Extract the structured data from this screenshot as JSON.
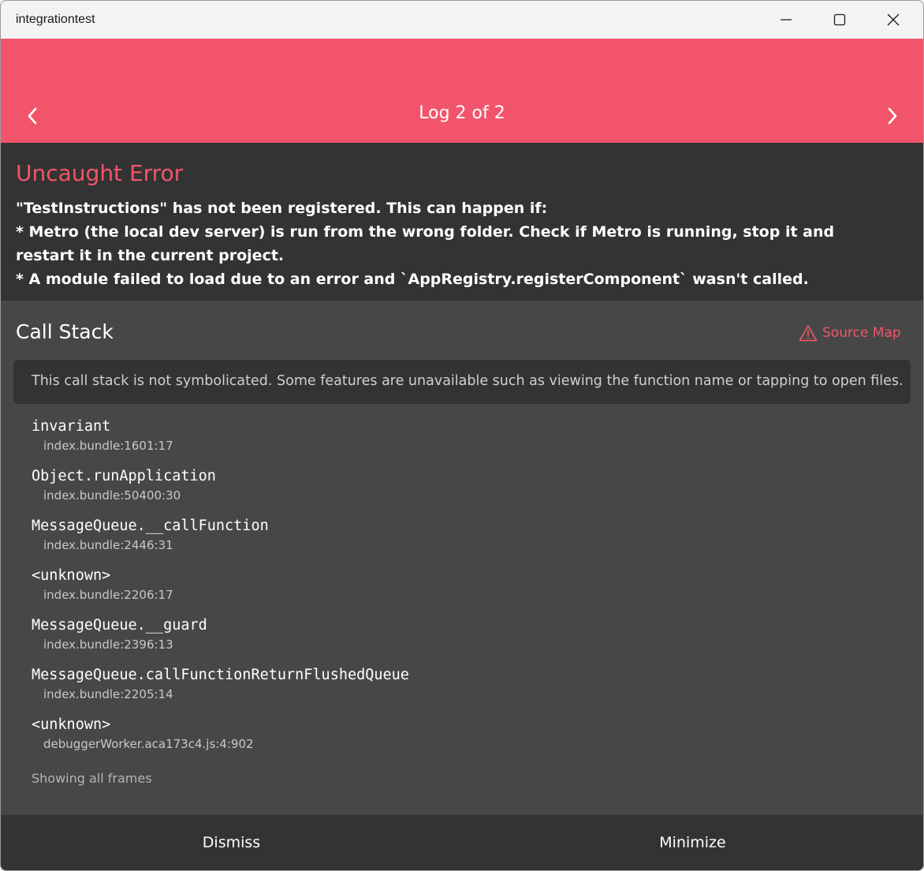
{
  "window": {
    "title": "integrationtest"
  },
  "header": {
    "log_title": "Log 2 of 2",
    "prev_icon": "chevron-left-icon",
    "next_icon": "chevron-right-icon",
    "accent_color": "#f2556b"
  },
  "error": {
    "title": "Uncaught Error",
    "message": "\"TestInstructions\" has not been registered. This can happen if:\n* Metro (the local dev server) is run from the wrong folder. Check if Metro is running, stop it and restart it in the current project.\n* A module failed to load due to an error and `AppRegistry.registerComponent` wasn't called."
  },
  "call_stack": {
    "heading": "Call Stack",
    "source_map_label": "Source Map",
    "source_map_icon": "warning-triangle-icon",
    "notice": "This call stack is not symbolicated. Some features are unavailable such as viewing the function name or tapping to open files.",
    "frames": [
      {
        "fn": "invariant",
        "loc": "index.bundle:1601:17"
      },
      {
        "fn": "Object.runApplication",
        "loc": "index.bundle:50400:30"
      },
      {
        "fn": "MessageQueue.__callFunction",
        "loc": "index.bundle:2446:31"
      },
      {
        "fn": "<unknown>",
        "loc": "index.bundle:2206:17"
      },
      {
        "fn": "MessageQueue.__guard",
        "loc": "index.bundle:2396:13"
      },
      {
        "fn": "MessageQueue.callFunctionReturnFlushedQueue",
        "loc": "index.bundle:2205:14"
      },
      {
        "fn": "<unknown>",
        "loc": "debuggerWorker.aca173c4.js:4:902"
      }
    ],
    "showing_label": "Showing all frames"
  },
  "footer": {
    "dismiss_label": "Dismiss",
    "minimize_label": "Minimize"
  }
}
